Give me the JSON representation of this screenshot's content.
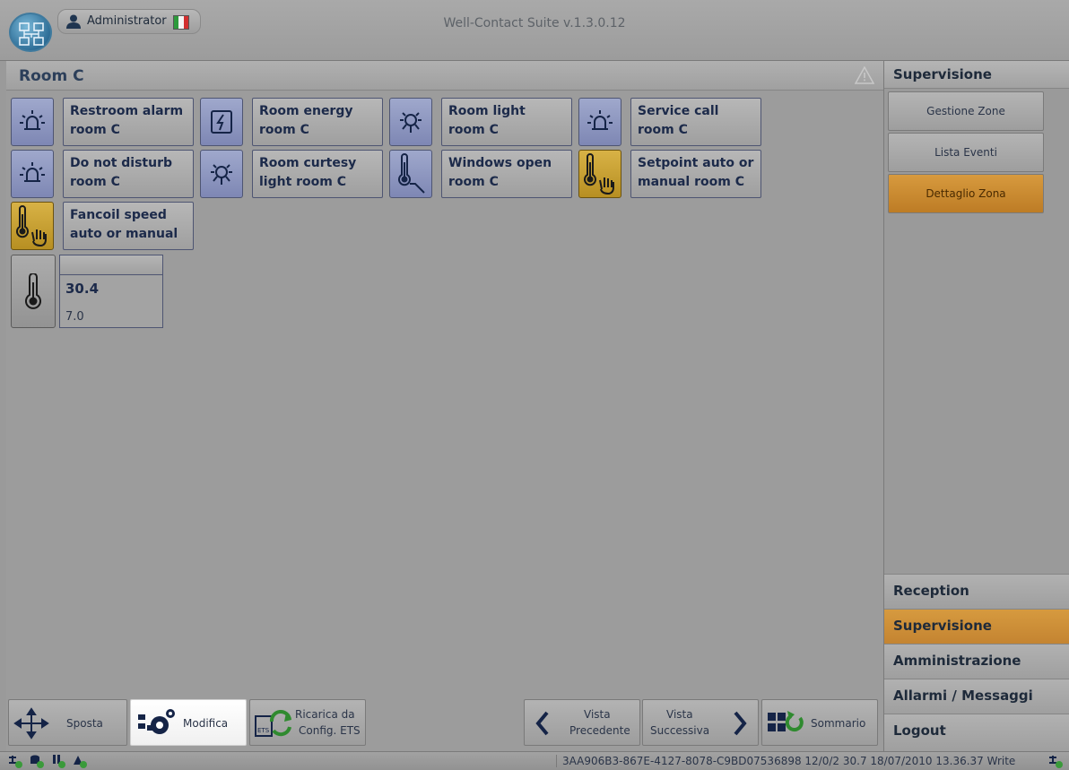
{
  "app": {
    "title": "Well-Contact Suite v.1.3.0.12",
    "user": "Administrator",
    "flag_colors": [
      "#2e9a3c",
      "#f4f4f4",
      "#d22f2f"
    ]
  },
  "room": {
    "title": "Room C",
    "devices": [
      {
        "label": "Restroom alarm room C",
        "icon": "alarm-light-icon",
        "style": "blue"
      },
      {
        "label": "Room energy room C",
        "icon": "energy-icon",
        "style": "blue"
      },
      {
        "label": "Room light room C",
        "icon": "bulb-icon",
        "style": "blue"
      },
      {
        "label": "Service call room C",
        "icon": "alarm-light-icon",
        "style": "blue"
      },
      {
        "label": "Do not disturb room C",
        "icon": "alarm-light-icon",
        "style": "blue"
      },
      {
        "label": "Room curtesy light room C",
        "icon": "bulb-icon",
        "style": "blue"
      },
      {
        "label": "Windows open room C",
        "icon": "window-thermometer-icon",
        "style": "blue"
      },
      {
        "label": "Setpoint auto or manual room C",
        "icon": "thermometer-hand-icon",
        "style": "yellow"
      },
      {
        "label": "Fancoil speed auto or manual",
        "icon": "thermometer-hand-icon",
        "style": "yellow"
      }
    ],
    "temperature": {
      "value": "30.4",
      "secondary": "7.0"
    }
  },
  "toolbar": {
    "sposta": "Sposta",
    "modifica": "Modifica",
    "ricarica": [
      "Ricarica da",
      "Config. ETS"
    ],
    "vista_precedente": [
      "Vista",
      "Precedente"
    ],
    "vista_successiva": [
      "Vista",
      "Successiva"
    ],
    "sommario": "Sommario"
  },
  "right_panel": {
    "header": "Supervisione",
    "buttons": [
      "Gestione Zone",
      "Lista Eventi",
      "Dettaglio Zona"
    ],
    "active_button": "Dettaglio Zona",
    "nav": [
      "Reception",
      "Supervisione",
      "Amministrazione",
      "Allarmi / Messaggi",
      "Logout"
    ],
    "active_nav": "Supervisione"
  },
  "status": {
    "text": "3AA906B3-867E-4127-8078-C9BD07536898 12/0/2 30.7 18/07/2010 13.36.37 Write"
  },
  "colors": {
    "accent_orange": "#c98a33",
    "device_blue": "#8a93bf",
    "device_yellow": "#c9a132"
  }
}
